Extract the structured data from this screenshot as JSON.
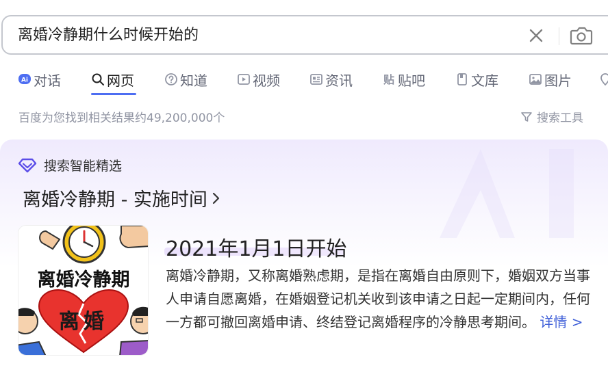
{
  "search": {
    "query": "离婚冷静期什么时候开始的"
  },
  "tabs": [
    {
      "label": "对话",
      "icon": "ai-chat-icon"
    },
    {
      "label": "网页",
      "icon": "search-icon"
    },
    {
      "label": "知道",
      "icon": "question-icon"
    },
    {
      "label": "视频",
      "icon": "video-icon"
    },
    {
      "label": "资讯",
      "icon": "news-icon"
    },
    {
      "label": "贴吧",
      "icon": "tieba-icon"
    },
    {
      "label": "文库",
      "icon": "doc-icon"
    },
    {
      "label": "图片",
      "icon": "image-icon"
    }
  ],
  "results": {
    "count_text": "百度为您找到相关结果约49,200,000个",
    "tools_label": "搜索工具"
  },
  "ai_card": {
    "header": "搜索智能精选",
    "title": "离婚冷静期 - 实施时间",
    "answer": "2021年1月1日开始",
    "description": "离婚冷静期，又称离婚熟虑期，是指在离婚自由原则下，婚姻双方当事人申请自愿离婚，在婚姻登记机关收到该申请之日起一定期间内，任何一方都可撤回离婚申请、终结登记离婚程序的冷静思考期间。",
    "more_link": "详情 >",
    "thumbnail": {
      "heading": "离婚冷静期",
      "heart_text": "离婚"
    }
  },
  "colors": {
    "accent": "#4e6ef2",
    "link": "#3f5fd8",
    "muted": "#9195a3"
  }
}
